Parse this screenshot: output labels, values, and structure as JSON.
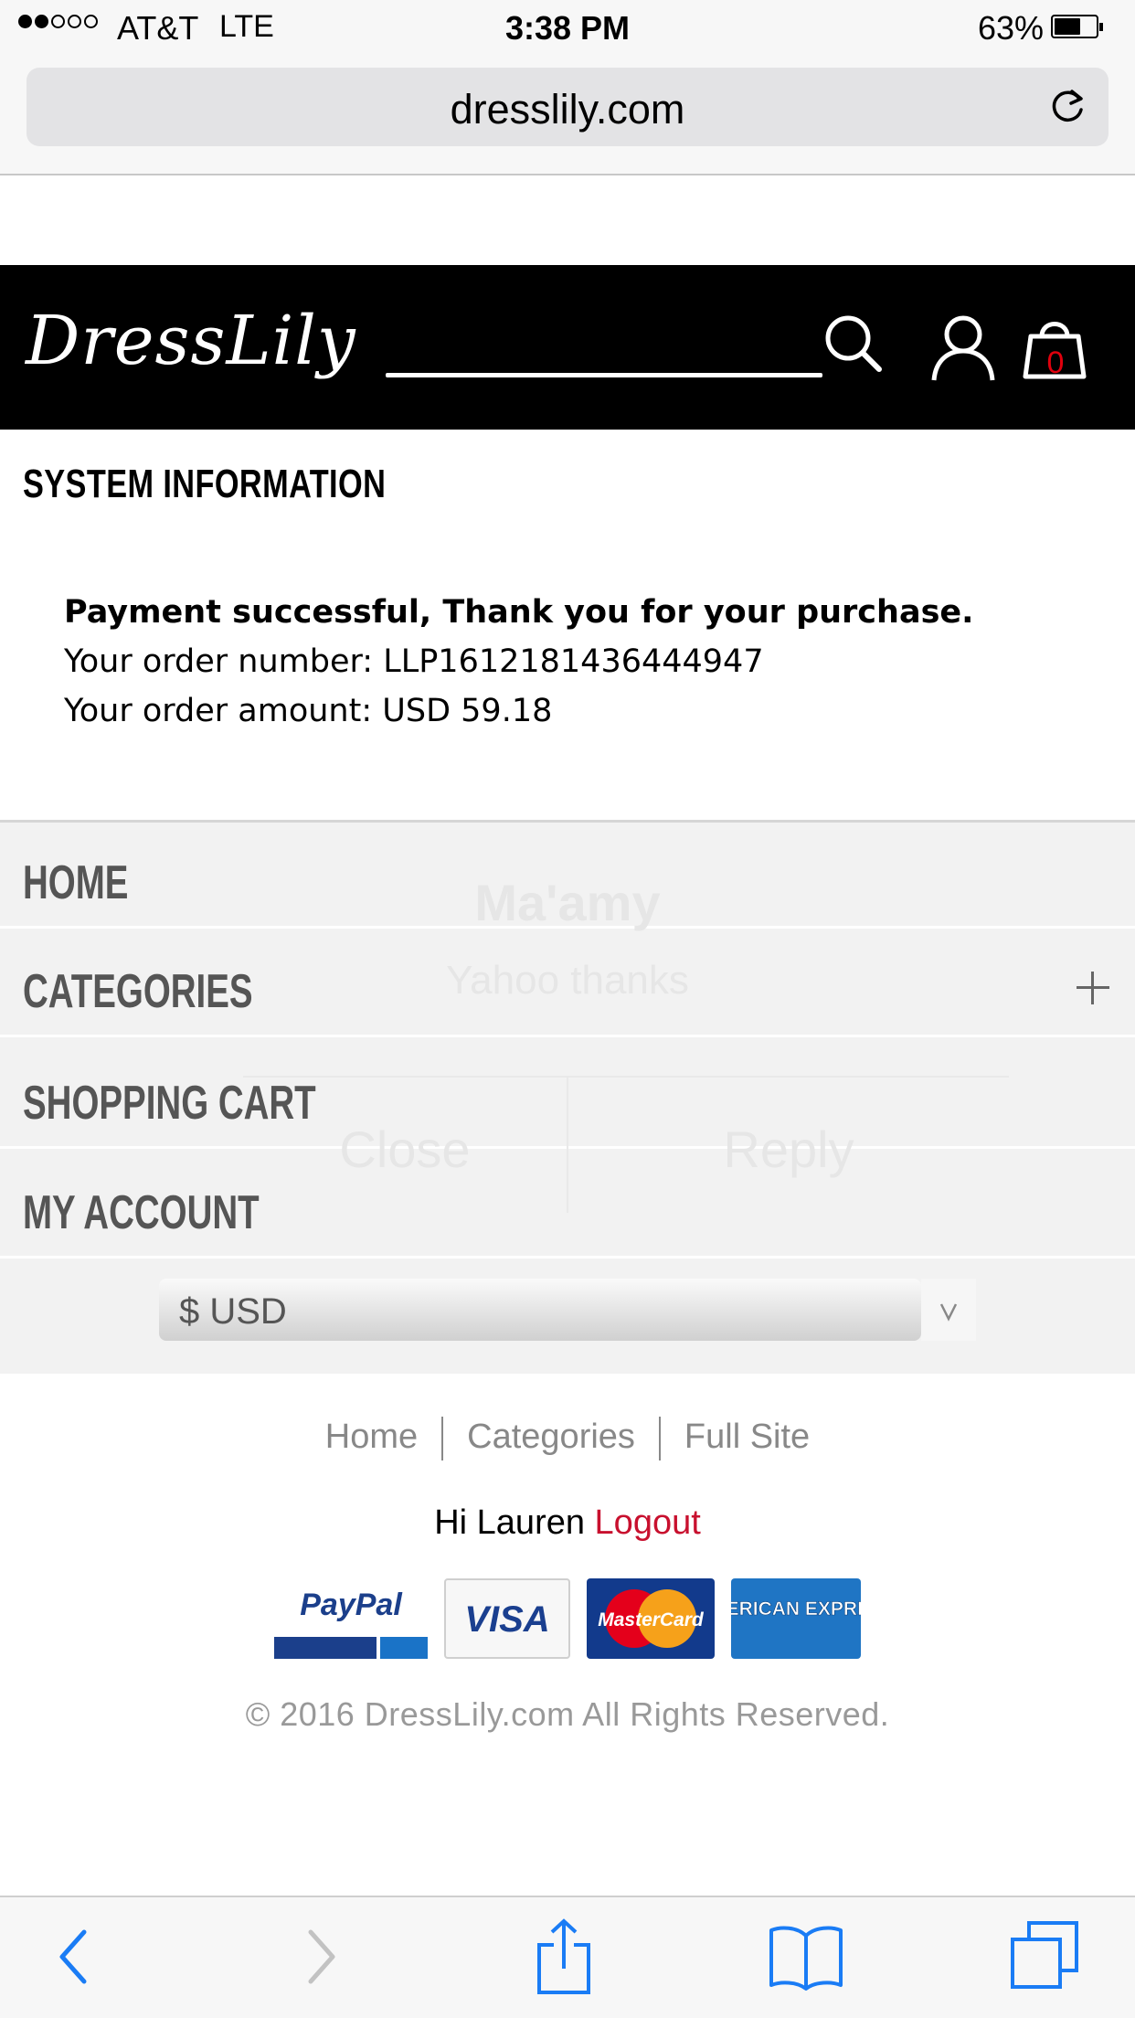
{
  "status_bar": {
    "carrier": "AT&T",
    "network": "LTE",
    "time": "3:38 PM",
    "battery_percent": "63%",
    "signal_bars": 2
  },
  "browser": {
    "url": "dresslily.com"
  },
  "header": {
    "logo": "DressLily",
    "cart_count": "0"
  },
  "system_info": {
    "title": "SYSTEM INFORMATION",
    "message": "Payment successful, Thank you for your purchase.",
    "order_number_line": "Your order number: LLP1612181436444947",
    "order_amount_line": "Your order amount: USD 59.18"
  },
  "menu": {
    "items": [
      {
        "label": "HOME"
      },
      {
        "label": "CATEGORIES"
      },
      {
        "label": "SHOPPING CART"
      },
      {
        "label": "MY ACCOUNT"
      }
    ],
    "currency": "$ USD"
  },
  "ghost_alert": {
    "title": "Ma'amy",
    "message": "Yahoo thanks",
    "close": "Close",
    "reply": "Reply"
  },
  "footer": {
    "links": [
      "Home",
      "Categories",
      "Full Site"
    ],
    "greeting": "Hi Lauren",
    "logout": "Logout",
    "payment_methods": [
      "PayPal",
      "VISA",
      "MasterCard",
      "AMERICAN EXPRESS"
    ],
    "copyright": "© 2016 DressLily.com All Rights Reserved."
  },
  "colors": {
    "header_bg": "#000000",
    "logout": "#c8102e",
    "cart_count": "#e0000d",
    "ios_blue": "#1a7cf5"
  }
}
